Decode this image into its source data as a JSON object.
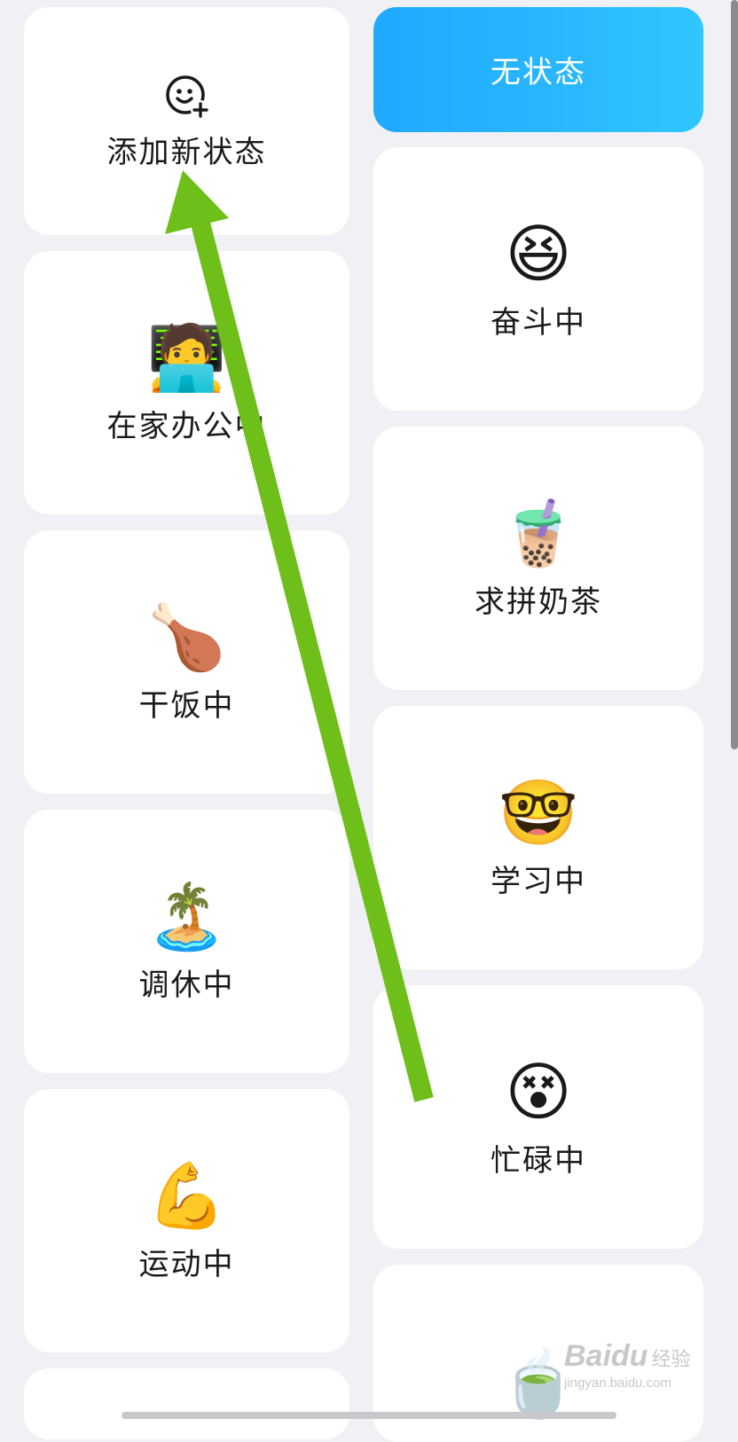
{
  "header": {
    "no_status_label": "无状态"
  },
  "add_card": {
    "icon": "add-emoji-icon",
    "label": "添加新状态"
  },
  "left_cards": [
    {
      "emoji": "🧑‍💻",
      "icon": "working-from-home-emoji",
      "label": "在家办公中"
    },
    {
      "emoji": "🍗",
      "icon": "chicken-leg-emoji",
      "label": "干饭中"
    },
    {
      "emoji": "🏝️",
      "icon": "island-emoji",
      "label": "调休中"
    },
    {
      "emoji": "💪",
      "icon": "flexed-bicep-emoji",
      "label": "运动中"
    }
  ],
  "right_cards": [
    {
      "emoji": "😆",
      "icon": "grinning-headband-emoji",
      "label": "奋斗中"
    },
    {
      "emoji": "🧋",
      "icon": "bubble-tea-emoji",
      "label": "求拼奶茶"
    },
    {
      "emoji": "🤓",
      "icon": "nerd-glasses-emoji",
      "label": "学习中"
    },
    {
      "emoji": "😵",
      "icon": "busy-laptop-emoji",
      "label": "忙碌中"
    },
    {
      "emoji": "🍵",
      "icon": "tea-cup-emoji",
      "label": ""
    }
  ],
  "annotation": {
    "arrow_color": "#6fbf1a"
  },
  "watermark": {
    "logo": "Baidu",
    "cn": "经验",
    "url": "jingyan.baidu.com"
  },
  "colors": {
    "accent_gradient_start": "#1fa9ff",
    "accent_gradient_end": "#30c6ff",
    "background": "#f1f1f5",
    "card": "#ffffff"
  }
}
